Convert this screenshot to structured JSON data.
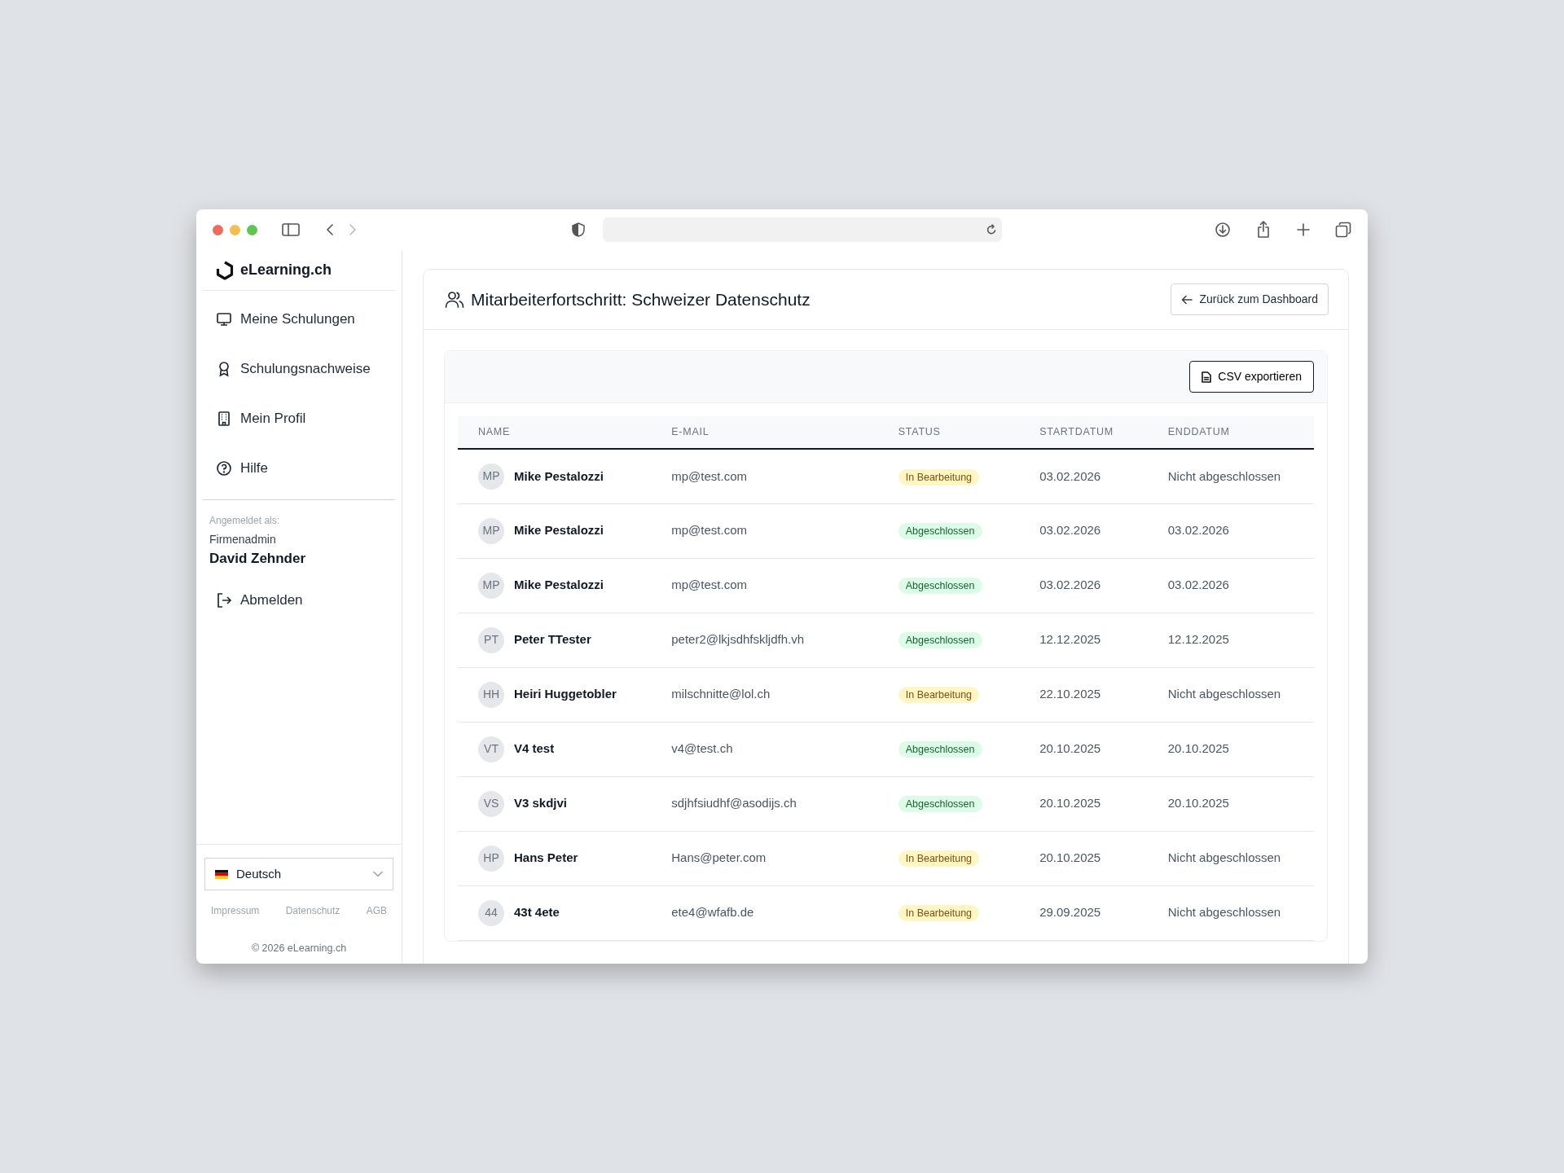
{
  "sidebar": {
    "brand": "eLearning.ch",
    "items": [
      {
        "label": "Meine Schulungen",
        "kind": "monitor"
      },
      {
        "label": "Schulungsnachweise",
        "kind": "award"
      },
      {
        "label": "Mein Profil",
        "kind": "building"
      },
      {
        "label": "Hilfe",
        "kind": "help"
      }
    ],
    "user": {
      "caption": "Angemeldet als:",
      "role": "Firmenadmin",
      "name": "David Zehnder"
    },
    "logout": "Abmelden",
    "language": "Deutsch",
    "footer_links": [
      "Impressum",
      "Datenschutz",
      "AGB"
    ],
    "copyright": "© 2026 eLearning.ch"
  },
  "page": {
    "title": "Mitarbeiterfortschritt: Schweizer Datenschutz",
    "back_button": "Zurück zum Dashboard",
    "export_button": "CSV exportieren"
  },
  "table": {
    "columns": [
      "NAME",
      "E-MAIL",
      "STATUS",
      "STARTDATUM",
      "ENDDATUM"
    ],
    "rows": [
      {
        "initials": "MP",
        "name": "Mike Pestalozzi",
        "email": "mp@test.com",
        "status": "In Bearbeitung",
        "kind": "progress",
        "start": "03.02.2026",
        "end": "Nicht abgeschlossen"
      },
      {
        "initials": "MP",
        "name": "Mike Pestalozzi",
        "email": "mp@test.com",
        "status": "Abgeschlossen",
        "kind": "done",
        "start": "03.02.2026",
        "end": "03.02.2026"
      },
      {
        "initials": "MP",
        "name": "Mike Pestalozzi",
        "email": "mp@test.com",
        "status": "Abgeschlossen",
        "kind": "done",
        "start": "03.02.2026",
        "end": "03.02.2026"
      },
      {
        "initials": "PT",
        "name": "Peter TTester",
        "email": "peter2@lkjsdhfskljdfh.vh",
        "status": "Abgeschlossen",
        "kind": "done",
        "start": "12.12.2025",
        "end": "12.12.2025"
      },
      {
        "initials": "HH",
        "name": "Heiri Huggetobler",
        "email": "milschnitte@lol.ch",
        "status": "In Bearbeitung",
        "kind": "progress",
        "start": "22.10.2025",
        "end": "Nicht abgeschlossen"
      },
      {
        "initials": "VT",
        "name": "V4 test",
        "email": "v4@test.ch",
        "status": "Abgeschlossen",
        "kind": "done",
        "start": "20.10.2025",
        "end": "20.10.2025"
      },
      {
        "initials": "VS",
        "name": "V3 skdjvi",
        "email": "sdjhfsiudhf@asodijs.ch",
        "status": "Abgeschlossen",
        "kind": "done",
        "start": "20.10.2025",
        "end": "20.10.2025"
      },
      {
        "initials": "HP",
        "name": "Hans Peter",
        "email": "Hans@peter.com",
        "status": "In Bearbeitung",
        "kind": "progress",
        "start": "20.10.2025",
        "end": "Nicht abgeschlossen"
      },
      {
        "initials": "44",
        "name": "43t 4ete",
        "email": "ete4@wfafb.de",
        "status": "In Bearbeitung",
        "kind": "progress",
        "start": "29.09.2025",
        "end": "Nicht abgeschlossen"
      }
    ]
  }
}
